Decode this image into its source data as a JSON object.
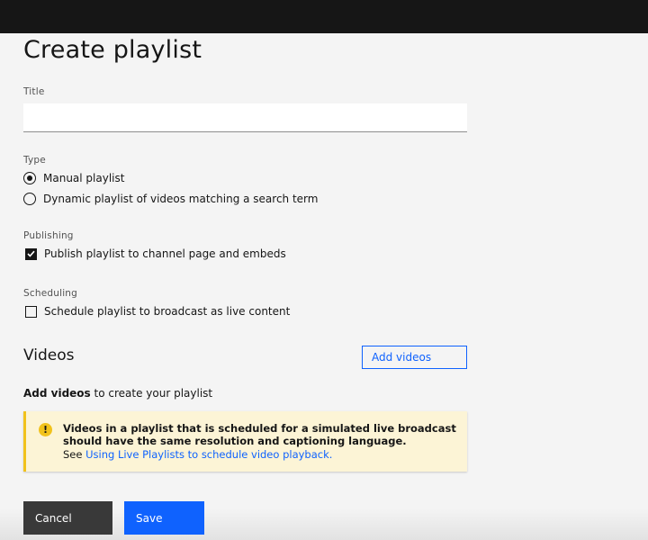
{
  "page": {
    "title": "Create playlist"
  },
  "title_field": {
    "label": "Title",
    "value": "",
    "placeholder": ""
  },
  "type_field": {
    "label": "Type",
    "options": [
      {
        "label": "Manual playlist",
        "selected": true
      },
      {
        "label": "Dynamic playlist of videos matching a search term",
        "selected": false
      }
    ]
  },
  "publishing": {
    "label": "Publishing",
    "checkbox_label": "Publish playlist to channel page and embeds",
    "checked": true
  },
  "scheduling": {
    "label": "Scheduling",
    "checkbox_label": "Schedule playlist to broadcast as live content",
    "checked": false
  },
  "videos": {
    "heading": "Videos",
    "add_button_label": "Add videos",
    "empty_hint_bold": "Add videos",
    "empty_hint_rest": " to create your playlist"
  },
  "notice": {
    "icon": "warning-icon",
    "title": "Videos in a playlist that is scheduled for a simulated live broadcast should have the same resolution and captioning language.",
    "body_prefix": "See ",
    "link_text": "Using Live Playlists to schedule video playback."
  },
  "footer": {
    "cancel_label": "Cancel",
    "save_label": "Save"
  },
  "colors": {
    "accent": "#0f62fe",
    "warning": "#f1c21b",
    "warning_bg": "#fcf4d6",
    "topbar": "#161616"
  }
}
